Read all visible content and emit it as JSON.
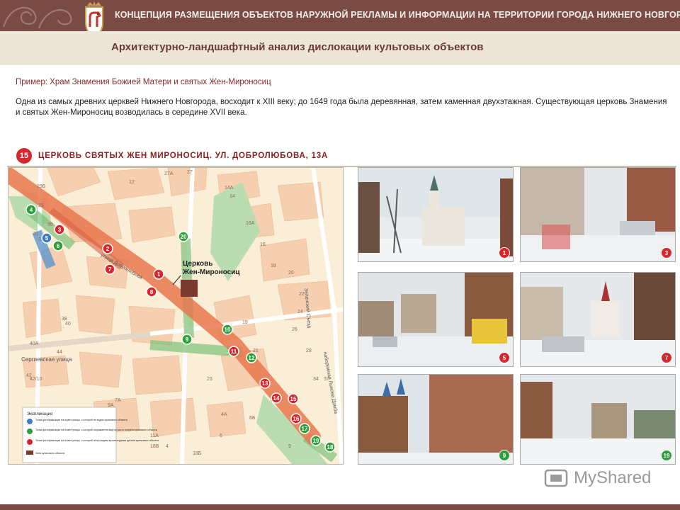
{
  "header": {
    "title": "КОНЦЕПЦИЯ РАЗМЕЩЕНИЯ ОБЪЕКТОВ НАРУЖНОЙ РЕКЛАМЫ И ИНФОРМАЦИИ НА ТЕРРИТОРИИ ГОРОДА НИЖНЕГО НОВГОРОДА",
    "subtitle": "Архитектурно-ландшафтный анализ дислокации культовых объектов"
  },
  "content": {
    "example": "Пример: Храм Знамения Божией Матери и святых Жен-Мироносиц",
    "description": "Одна из самых древних церквей Нижнего Новгорода, восходит к XIII веку; до 1649 года была деревянная, затем каменная двухэтажная. Существующая церковь Знамения и святых Жен-Мироносиц возводилась в середине XVII века."
  },
  "panel": {
    "badge": "15",
    "title": "ЦЕРКОВЬ СВЯТЫХ ЖЕН МИРОНОСИЦ. УЛ. ДОБРОЛЮБОВА, 13А"
  },
  "map": {
    "church_label_1": "Церковь",
    "church_label_2": "Жен-Мироносиц",
    "street_sergievskaya": "Сергиевская улица",
    "street_dobrolyubova": "улица Добролюбова",
    "street_naberezhnaya": "набережная Лыкова Дамба",
    "street_zelensky": "Зеленский Съезд",
    "building_numbers": [
      "27A",
      "27",
      "29Б",
      "29",
      "31",
      "33A",
      "35",
      "12",
      "14A",
      "14",
      "16A",
      "16",
      "18",
      "20",
      "22",
      "24",
      "26",
      "28",
      "34",
      "37",
      "38",
      "40",
      "40A",
      "42",
      "42/10",
      "44",
      "7A",
      "9A",
      "11A",
      "4",
      "4A",
      "6",
      "6Б",
      "6В",
      "9",
      "18Б",
      "18В",
      "19",
      "21",
      "23"
    ],
    "markers_red": [
      "1",
      "2",
      "3",
      "7",
      "8",
      "11",
      "13",
      "14",
      "15",
      "16"
    ],
    "markers_green": [
      "4",
      "6",
      "9",
      "10",
      "12",
      "17",
      "18",
      "19",
      "20"
    ],
    "markers_blue": [
      "5"
    ],
    "legend": {
      "title": "Экспликация",
      "item1": "Точка фотофиксации на плане улицы, с которой не видно культового объекта",
      "item2": "Точка фотофиксации на плане улицы, с которой открывается вид на часть силуэта культового объекта",
      "item3": "Точка фотофиксации на плане улицы, с которой четко видны архитектурные детали культового объекта",
      "item4": "Зона культового объекта"
    }
  },
  "photos": [
    {
      "num": "1",
      "color": "#d7262e"
    },
    {
      "num": "3",
      "color": "#d7262e"
    },
    {
      "num": "5",
      "color": "#d7262e"
    },
    {
      "num": "7",
      "color": "#d7262e"
    },
    {
      "num": "9",
      "color": "#2e9e3c"
    },
    {
      "num": "19",
      "color": "#2e9e3c"
    }
  ],
  "watermark": "MyShared",
  "colors": {
    "header": "#7a4a45",
    "red": "#d7262e",
    "green": "#2e9e3c",
    "blue": "#3e7ec0"
  }
}
